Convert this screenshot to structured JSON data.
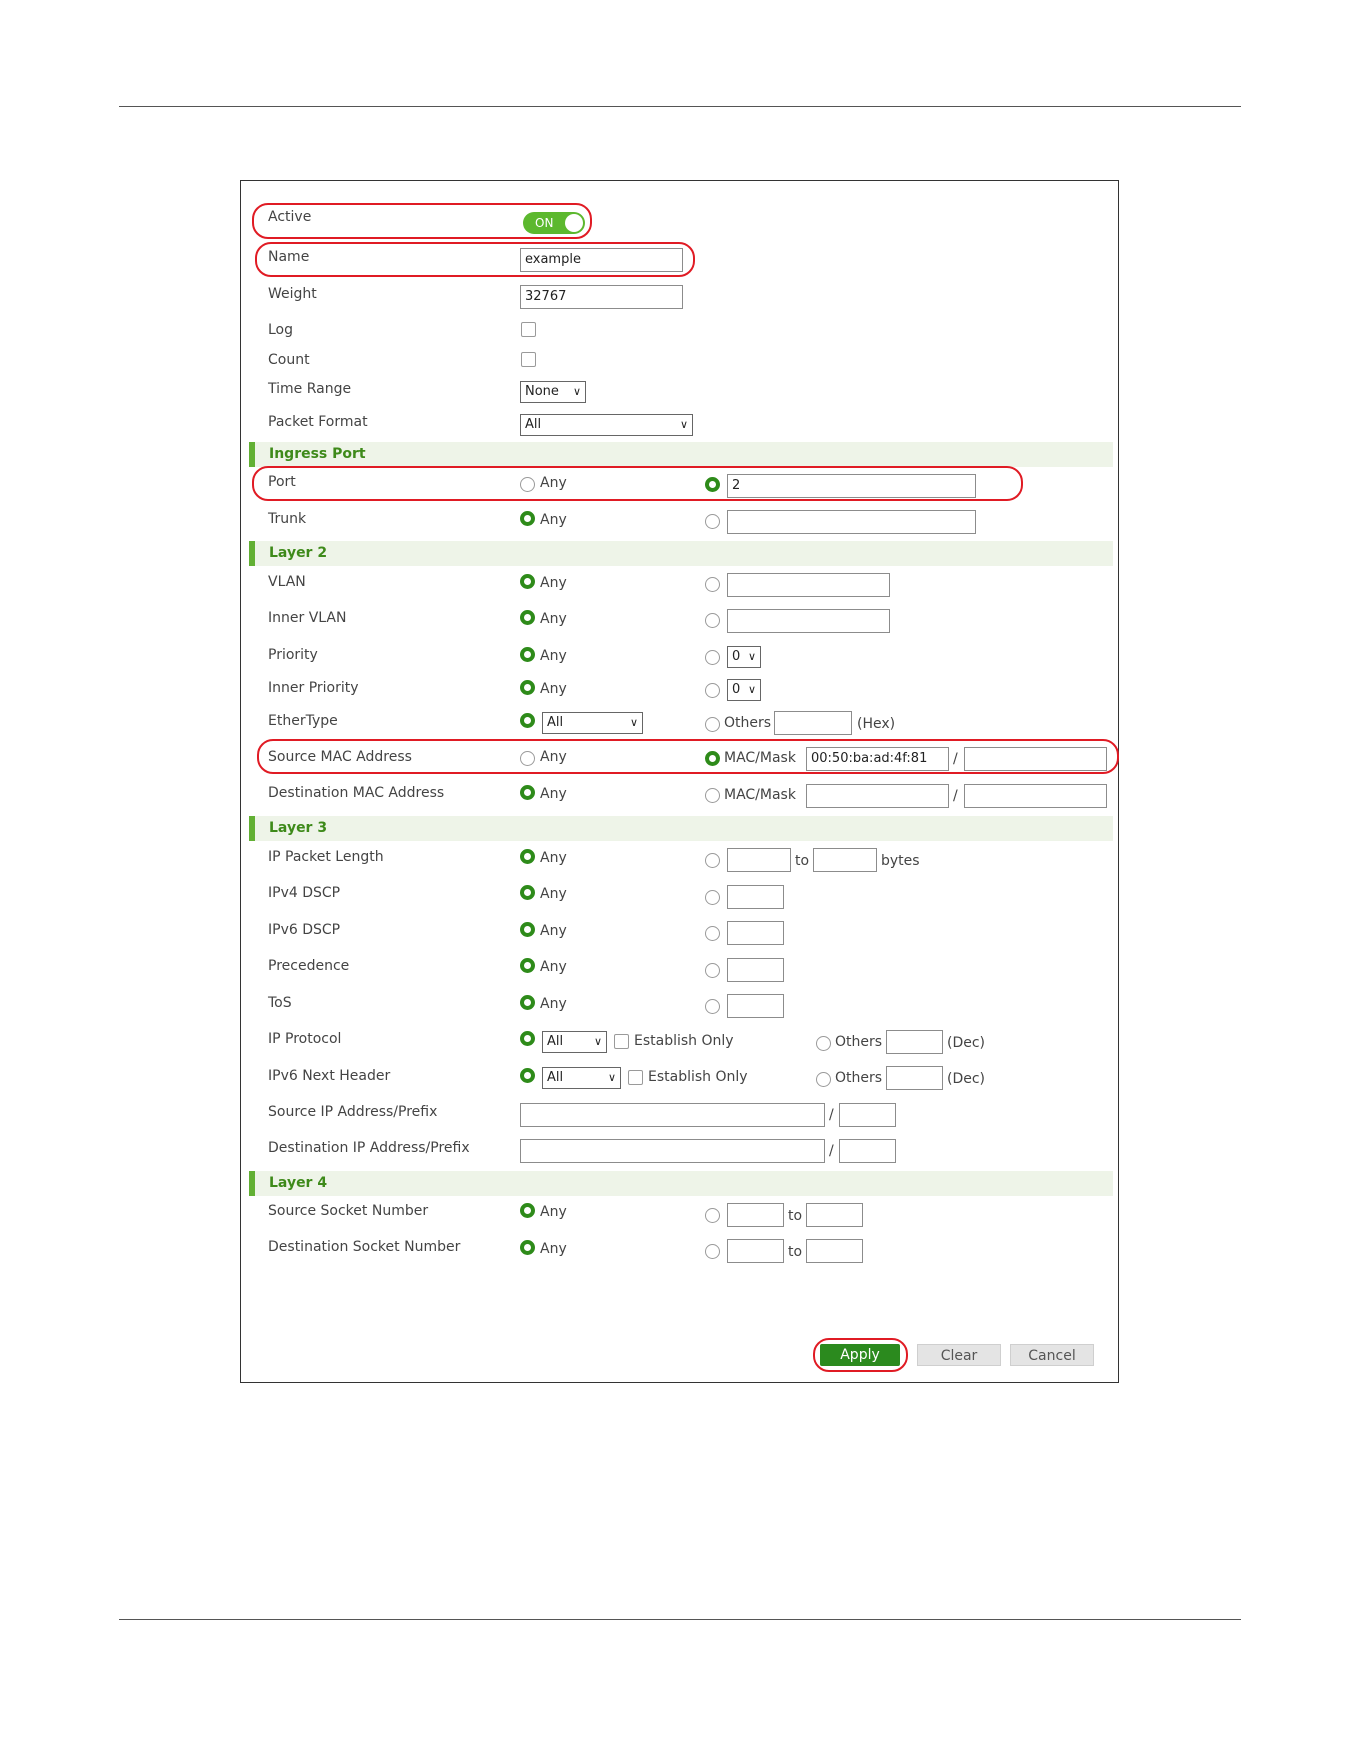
{
  "form": {
    "active_label": "Active",
    "toggle_text": "ON",
    "name_label": "Name",
    "name_value": "example",
    "weight_label": "Weight",
    "weight_value": "32767",
    "log_label": "Log",
    "count_label": "Count",
    "time_range_label": "Time Range",
    "time_range_value": "None",
    "packet_format_label": "Packet Format",
    "packet_format_value": "All"
  },
  "ingress": {
    "title": "Ingress Port",
    "port_label": "Port",
    "port_any": "Any",
    "port_value": "2",
    "trunk_label": "Trunk",
    "trunk_any": "Any"
  },
  "layer2": {
    "title": "Layer 2",
    "vlan_label": "VLAN",
    "vlan_any": "Any",
    "inner_vlan_label": "Inner VLAN",
    "inner_vlan_any": "Any",
    "priority_label": "Priority",
    "priority_any": "Any",
    "priority_value": "0",
    "inner_priority_label": "Inner Priority",
    "inner_priority_any": "Any",
    "inner_priority_value": "0",
    "ethertype_label": "EtherType",
    "ethertype_value": "All",
    "ethertype_others": "Others",
    "ethertype_hex": "(Hex)",
    "src_mac_label": "Source MAC Address",
    "src_mac_any": "Any",
    "src_mac_option": "MAC/Mask",
    "src_mac_value": "00:50:ba:ad:4f:81",
    "src_mac_slash": "/",
    "dst_mac_label": "Destination MAC Address",
    "dst_mac_any": "Any",
    "dst_mac_option": "MAC/Mask",
    "dst_mac_slash": "/"
  },
  "layer3": {
    "title": "Layer 3",
    "ip_len_label": "IP Packet Length",
    "ip_len_any": "Any",
    "ip_len_to": "to",
    "ip_len_bytes": "bytes",
    "ipv4_dscp_label": "IPv4 DSCP",
    "ipv4_dscp_any": "Any",
    "ipv6_dscp_label": "IPv6 DSCP",
    "ipv6_dscp_any": "Any",
    "precedence_label": "Precedence",
    "precedence_any": "Any",
    "tos_label": "ToS",
    "tos_any": "Any",
    "ip_protocol_label": "IP Protocol",
    "ip_protocol_value": "All",
    "ip_protocol_establish": "Establish Only",
    "ip_protocol_others": "Others",
    "ip_protocol_dec": "(Dec)",
    "ipv6_next_label": "IPv6 Next Header",
    "ipv6_next_value": "All",
    "ipv6_next_establish": "Establish Only",
    "ipv6_next_others": "Others",
    "ipv6_next_dec": "(Dec)",
    "src_ip_label": "Source IP Address/Prefix",
    "src_ip_slash": "/",
    "dst_ip_label": "Destination IP Address/Prefix",
    "dst_ip_slash": "/"
  },
  "layer4": {
    "title": "Layer 4",
    "src_socket_label": "Source Socket Number",
    "src_socket_any": "Any",
    "src_socket_to": "to",
    "dst_socket_label": "Destination Socket Number",
    "dst_socket_any": "Any",
    "dst_socket_to": "to"
  },
  "buttons": {
    "apply": "Apply",
    "clear": "Clear",
    "cancel": "Cancel"
  },
  "colors": {
    "accent": "#2e8b1a",
    "toggle": "#5cb82e",
    "callout": "#e01b24",
    "section_bg": "#eef4e8"
  }
}
